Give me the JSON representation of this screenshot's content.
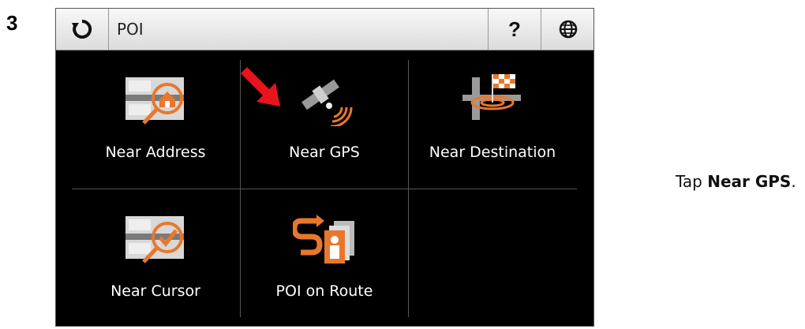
{
  "step": {
    "number": "3"
  },
  "titlebar": {
    "title": "POI",
    "help_label": "?"
  },
  "tiles": [
    {
      "label": "Near Address",
      "icon": "near-address-icon"
    },
    {
      "label": "Near GPS",
      "icon": "near-gps-icon"
    },
    {
      "label": "Near Destination",
      "icon": "near-destination-icon"
    },
    {
      "label": "Near Cursor",
      "icon": "near-cursor-icon"
    },
    {
      "label": "POI on Route",
      "icon": "poi-on-route-icon"
    }
  ],
  "instruction": {
    "prefix": "Tap ",
    "emphasis": "Near GPS",
    "suffix": "."
  },
  "colors": {
    "accent": "#e8772e",
    "callout_arrow": "#e8141b",
    "screen_bg": "#000000"
  }
}
